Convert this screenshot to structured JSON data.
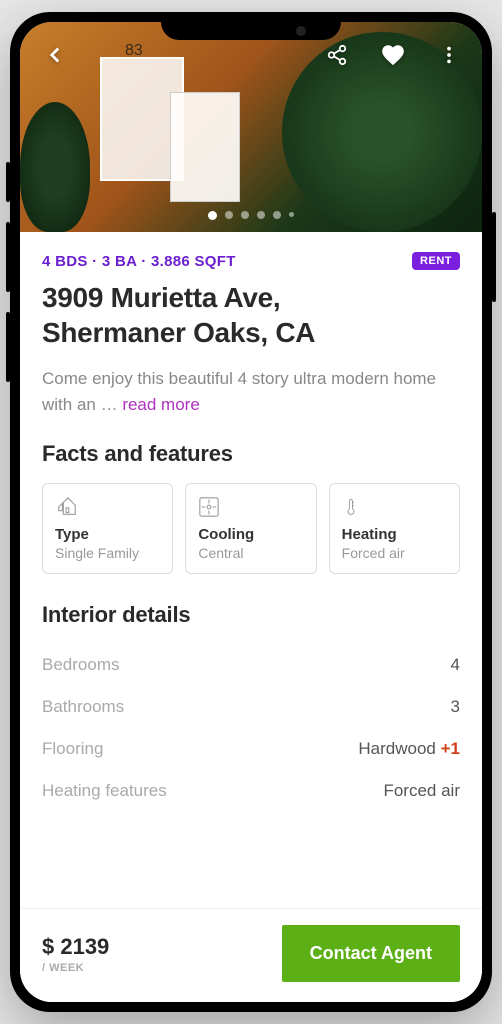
{
  "listing": {
    "beds": "4 BDS",
    "baths": "3 BA",
    "sqft": "3.886 SQFT",
    "badge": "RENT",
    "address_line1": "3909 Murietta Ave,",
    "address_line2": "Shermaner Oaks, CA",
    "description": "Come enjoy this beautiful 4 story ultra modern home with an … ",
    "read_more": "read more"
  },
  "sections": {
    "facts": "Facts and features",
    "interior": "Interior details"
  },
  "facts": [
    {
      "icon": "house-icon",
      "label": "Type",
      "value": "Single Family"
    },
    {
      "icon": "fan-icon",
      "label": "Cooling",
      "value": "Central"
    },
    {
      "icon": "thermometer-icon",
      "label": "Heating",
      "value": "Forced air"
    }
  ],
  "interior": [
    {
      "k": "Bedrooms",
      "v": "4"
    },
    {
      "k": "Bathrooms",
      "v": "3"
    },
    {
      "k": "Flooring",
      "v": "Hardwood ",
      "extra": "+1"
    },
    {
      "k": "Heating features",
      "v": "Forced air"
    }
  ],
  "footer": {
    "price": "$ 2139",
    "period": "/ WEEK",
    "cta": "Contact Agent"
  },
  "carousel": {
    "count": 6,
    "active": 0
  }
}
